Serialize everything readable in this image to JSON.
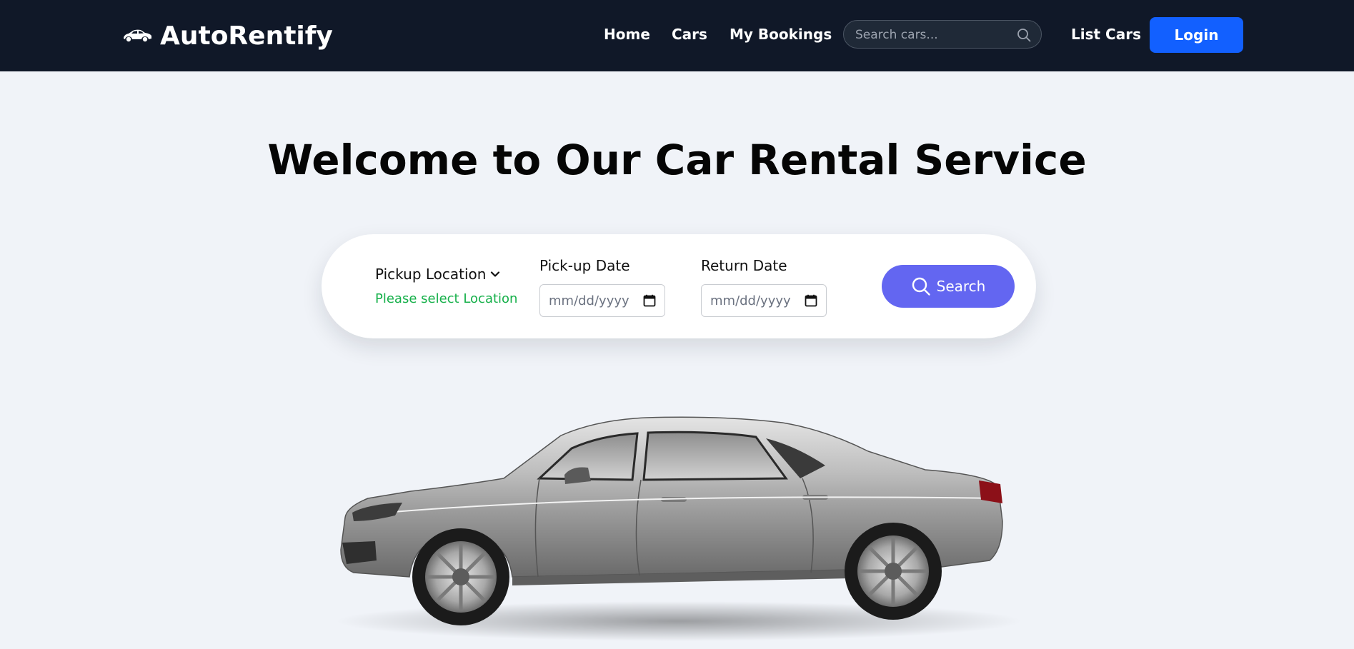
{
  "navbar": {
    "brand": "AutoRentify",
    "brand_icon": "car-icon",
    "links": [
      "Home",
      "Cars",
      "My Bookings"
    ],
    "search_placeholder": "Search cars...",
    "search_icon": "search-icon",
    "list_cars": "List Cars",
    "login": "Login",
    "colors": {
      "background": "#101828",
      "login_button": "#1260ff"
    }
  },
  "hero": {
    "title": "Welcome to Our Car Rental Service",
    "image": "silver-sedan-image"
  },
  "search_form": {
    "pickup_location_label": "Pickup Location",
    "pickup_location_hint": "Please select Location",
    "pickup_date_label": "Pick-up Date",
    "pickup_date_placeholder": "mm/dd/yyyy",
    "return_date_label": "Return Date",
    "return_date_placeholder": "mm/dd/yyyy",
    "search_button": "Search",
    "colors": {
      "search_button": "#6366f1",
      "hint": "#16b04a"
    }
  }
}
